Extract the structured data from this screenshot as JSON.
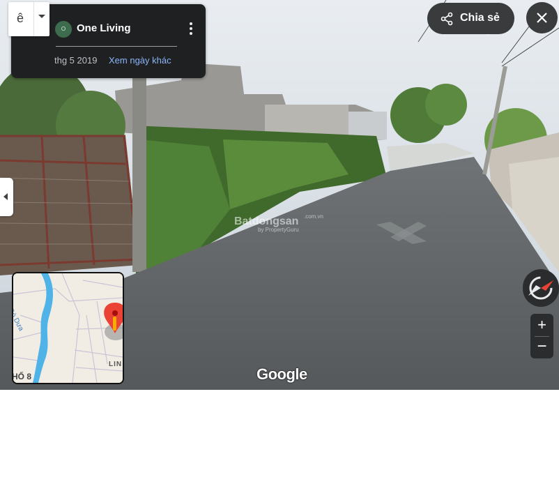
{
  "place": {
    "name": "One Living",
    "logo_text": "O\nLiving",
    "date": "thg 5 2019",
    "other_dates_link": "Xem ngày khác"
  },
  "top_left_control": {
    "glyph": "ê"
  },
  "share": {
    "label": "Chia sẻ"
  },
  "minimap": {
    "river_label": "Gò Dưa",
    "district_label": "HỐ 8",
    "road_label": "LIN"
  },
  "watermark": {
    "brand": "Batdongsan",
    "domain": ".com.vn",
    "sub": "by PropertyGuru"
  },
  "attribution": {
    "logo": "Google"
  },
  "zoom": {
    "in_label": "+",
    "out_label": "−"
  },
  "colors": {
    "panel": "#1f2022",
    "link": "#8ab4f8",
    "pin": "#ea4335",
    "river": "#4fb3e8"
  },
  "icons": [
    "kebab-menu-icon",
    "share-icon",
    "close-icon",
    "compass-icon",
    "map-pin-icon",
    "collapse-arrow-icon",
    "dropdown-caret-icon"
  ]
}
